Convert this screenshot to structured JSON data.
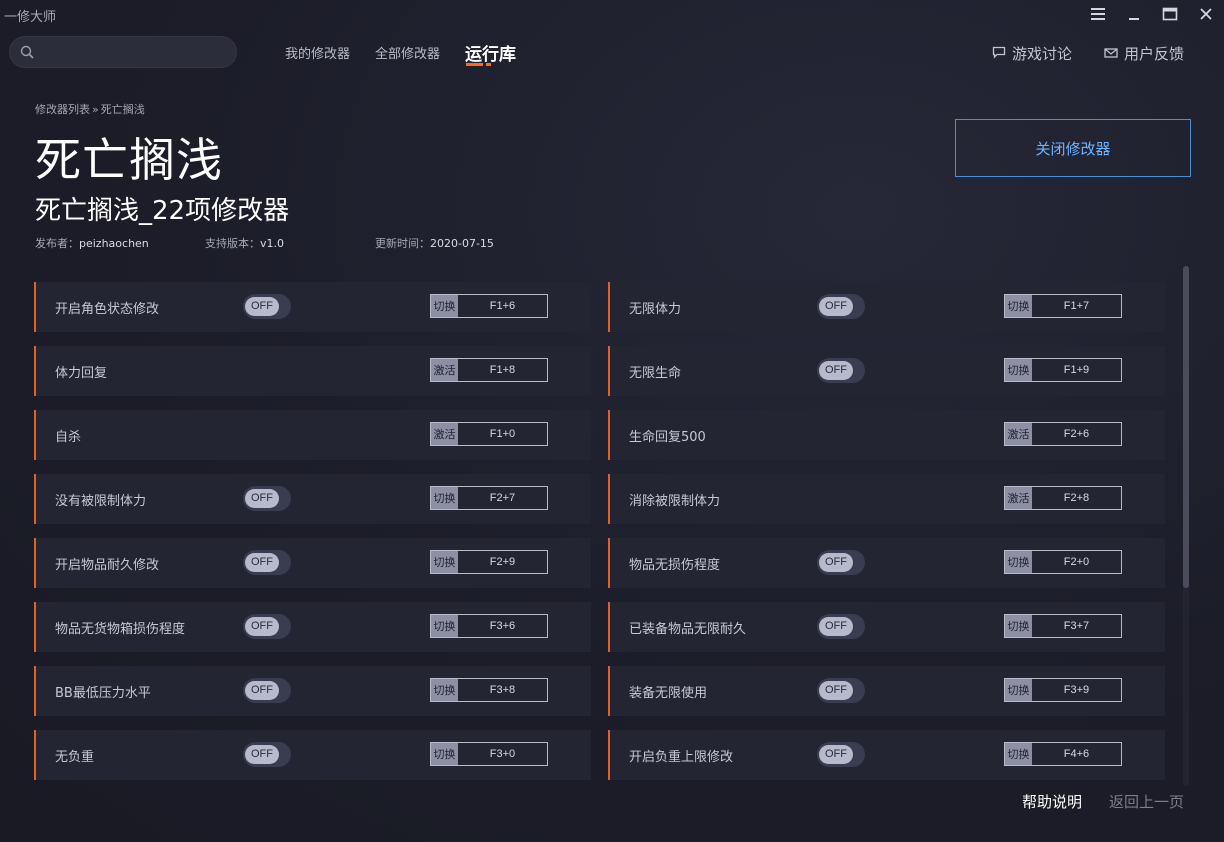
{
  "app": {
    "title": "一修大师"
  },
  "window": {
    "menu_icon": "hamburger-icon",
    "minimize_icon": "minimize-icon",
    "maximize_icon": "maximize-icon",
    "close_icon": "close-icon"
  },
  "search": {
    "placeholder": "",
    "value": ""
  },
  "nav": {
    "tabs": [
      {
        "label": "我的修改器",
        "active": false
      },
      {
        "label": "全部修改器",
        "active": false
      },
      {
        "label": "运行库",
        "active": true
      }
    ],
    "forum": "游戏讨论",
    "feedback": "用户反馈"
  },
  "breadcrumb": {
    "root": "修改器列表",
    "separator": "»",
    "current": "死亡搁浅"
  },
  "game": {
    "title": "死亡搁浅",
    "subtitle": "死亡搁浅_22项修改器",
    "publisher_label": "发布者：",
    "publisher": "peizhaochen",
    "version_label": "支持版本：",
    "version": "v1.0",
    "updated_label": "更新时间：",
    "updated": "2020-07-15"
  },
  "close_button": "关闭修改器",
  "toggle_off_text": "OFF",
  "colors": {
    "accent": "#e0622a",
    "nav_underline": "#ff6a1f",
    "close_button": "#4a8fd6",
    "background": "#1b1c27",
    "row": "#242533"
  },
  "options": [
    {
      "label": "开启角色状态修改",
      "toggle": true,
      "toggle_state": "OFF",
      "kind": "切换",
      "key": "F1+6"
    },
    {
      "label": "无限体力",
      "toggle": true,
      "toggle_state": "OFF",
      "kind": "切换",
      "key": "F1+7"
    },
    {
      "label": "体力回复",
      "toggle": false,
      "kind": "激活",
      "key": "F1+8"
    },
    {
      "label": "无限生命",
      "toggle": true,
      "toggle_state": "OFF",
      "kind": "切换",
      "key": "F1+9"
    },
    {
      "label": "自杀",
      "toggle": false,
      "kind": "激活",
      "key": "F1+0"
    },
    {
      "label": "生命回复500",
      "toggle": false,
      "kind": "激活",
      "key": "F2+6"
    },
    {
      "label": "没有被限制体力",
      "toggle": true,
      "toggle_state": "OFF",
      "kind": "切换",
      "key": "F2+7"
    },
    {
      "label": "消除被限制体力",
      "toggle": false,
      "kind": "激活",
      "key": "F2+8"
    },
    {
      "label": "开启物品耐久修改",
      "toggle": true,
      "toggle_state": "OFF",
      "kind": "切换",
      "key": "F2+9"
    },
    {
      "label": "物品无损伤程度",
      "toggle": true,
      "toggle_state": "OFF",
      "kind": "切换",
      "key": "F2+0"
    },
    {
      "label": "物品无货物箱损伤程度",
      "toggle": true,
      "toggle_state": "OFF",
      "kind": "切换",
      "key": "F3+6"
    },
    {
      "label": "已装备物品无限耐久",
      "toggle": true,
      "toggle_state": "OFF",
      "kind": "切换",
      "key": "F3+7"
    },
    {
      "label": "BB最低压力水平",
      "toggle": true,
      "toggle_state": "OFF",
      "kind": "切换",
      "key": "F3+8"
    },
    {
      "label": "装备无限使用",
      "toggle": true,
      "toggle_state": "OFF",
      "kind": "切换",
      "key": "F3+9"
    },
    {
      "label": "无负重",
      "toggle": true,
      "toggle_state": "OFF",
      "kind": "切换",
      "key": "F3+0"
    },
    {
      "label": "开启负重上限修改",
      "toggle": true,
      "toggle_state": "OFF",
      "kind": "切换",
      "key": "F4+6"
    }
  ],
  "footer": {
    "help": "帮助说明",
    "back": "返回上一页"
  }
}
